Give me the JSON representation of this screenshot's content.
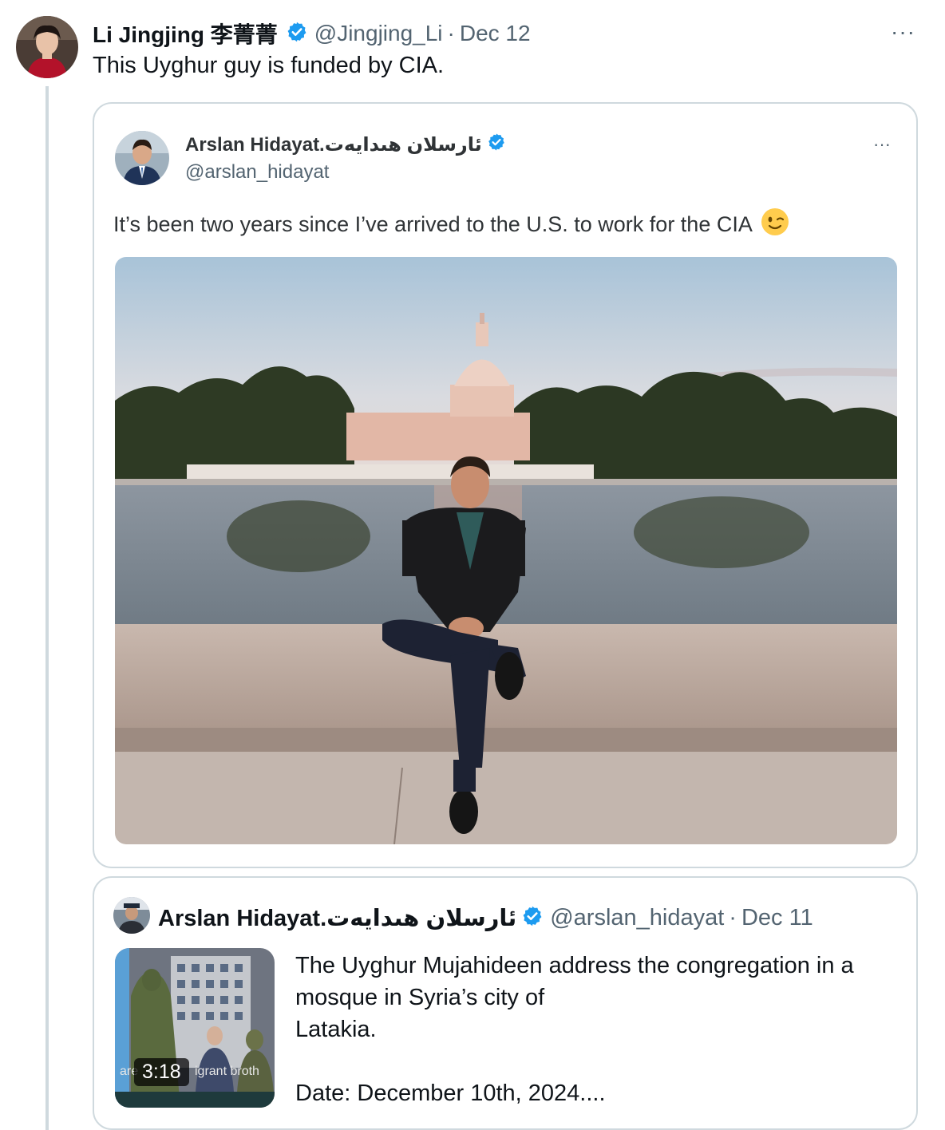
{
  "tweet": {
    "author_name": "Li Jingjing 李菁菁",
    "handle": "@Jingjing_Li",
    "separator": "·",
    "date": "Dec 12",
    "more": "···",
    "text": "This Uyghur guy is funded by CIA."
  },
  "quoted_screenshot": {
    "author_name": "Arslan Hidayat.ئارسلان ھىدايەت",
    "handle": "@arslan_hidayat",
    "more": "···",
    "text": "It’s been two years since I’ve arrived to the U.S. to work for the CIA",
    "emoji": "winking-face"
  },
  "quoted_tweet": {
    "author_name": "Arslan Hidayat.ئارسلان ھىدايەت",
    "handle": "@arslan_hidayat",
    "separator": "·",
    "date": "Dec 11",
    "video_duration": "3:18",
    "video_caption_left": "are",
    "video_caption_right": "igrant broth",
    "text_lines": [
      "The Uyghur Mujahideen address the congregation in a",
      "mosque in Syria’s city of",
      "Latakia.",
      "",
      "Date: December 10th, 2024...."
    ]
  },
  "colors": {
    "verified": "#1d9bf0",
    "secondary_text": "#536471",
    "border": "#cfd9de"
  }
}
